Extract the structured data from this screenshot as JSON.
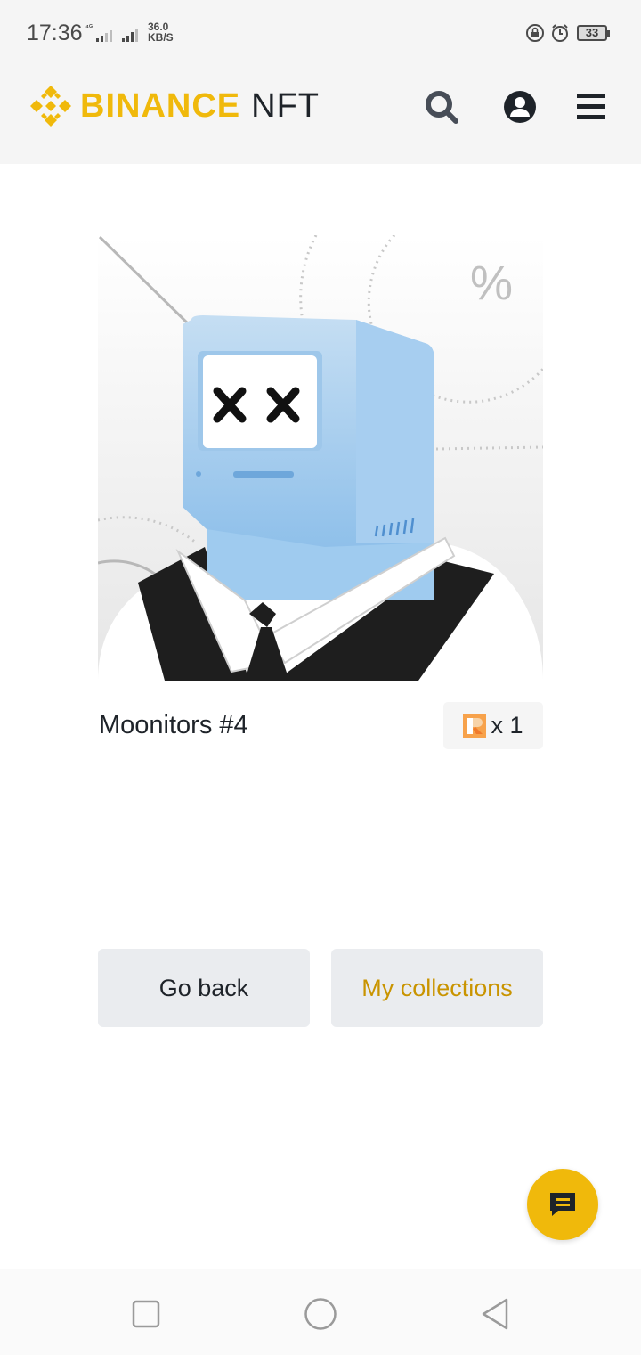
{
  "status_bar": {
    "time": "17:36",
    "network": "4G+4.5G",
    "speed_value": "36.0",
    "speed_unit": "KB/S",
    "battery": "33"
  },
  "header": {
    "brand": "BINANCE",
    "product": "NFT",
    "icons": [
      "search-icon",
      "account-icon",
      "menu-icon"
    ]
  },
  "nft": {
    "title": "Moonitors #4",
    "rarity_icon": "rarity-r-icon",
    "count": "x 1"
  },
  "actions": {
    "go_back_label": "Go back",
    "collections_label": "My collections"
  },
  "fab": {
    "icon": "chat-icon"
  },
  "nav": {
    "icons": [
      "recent-apps-icon",
      "home-icon",
      "back-icon"
    ]
  },
  "colors": {
    "brand_yellow": "#f0b90b",
    "collections_text": "#c99400",
    "button_bg": "#eaecef",
    "header_bg": "#f5f5f5"
  }
}
